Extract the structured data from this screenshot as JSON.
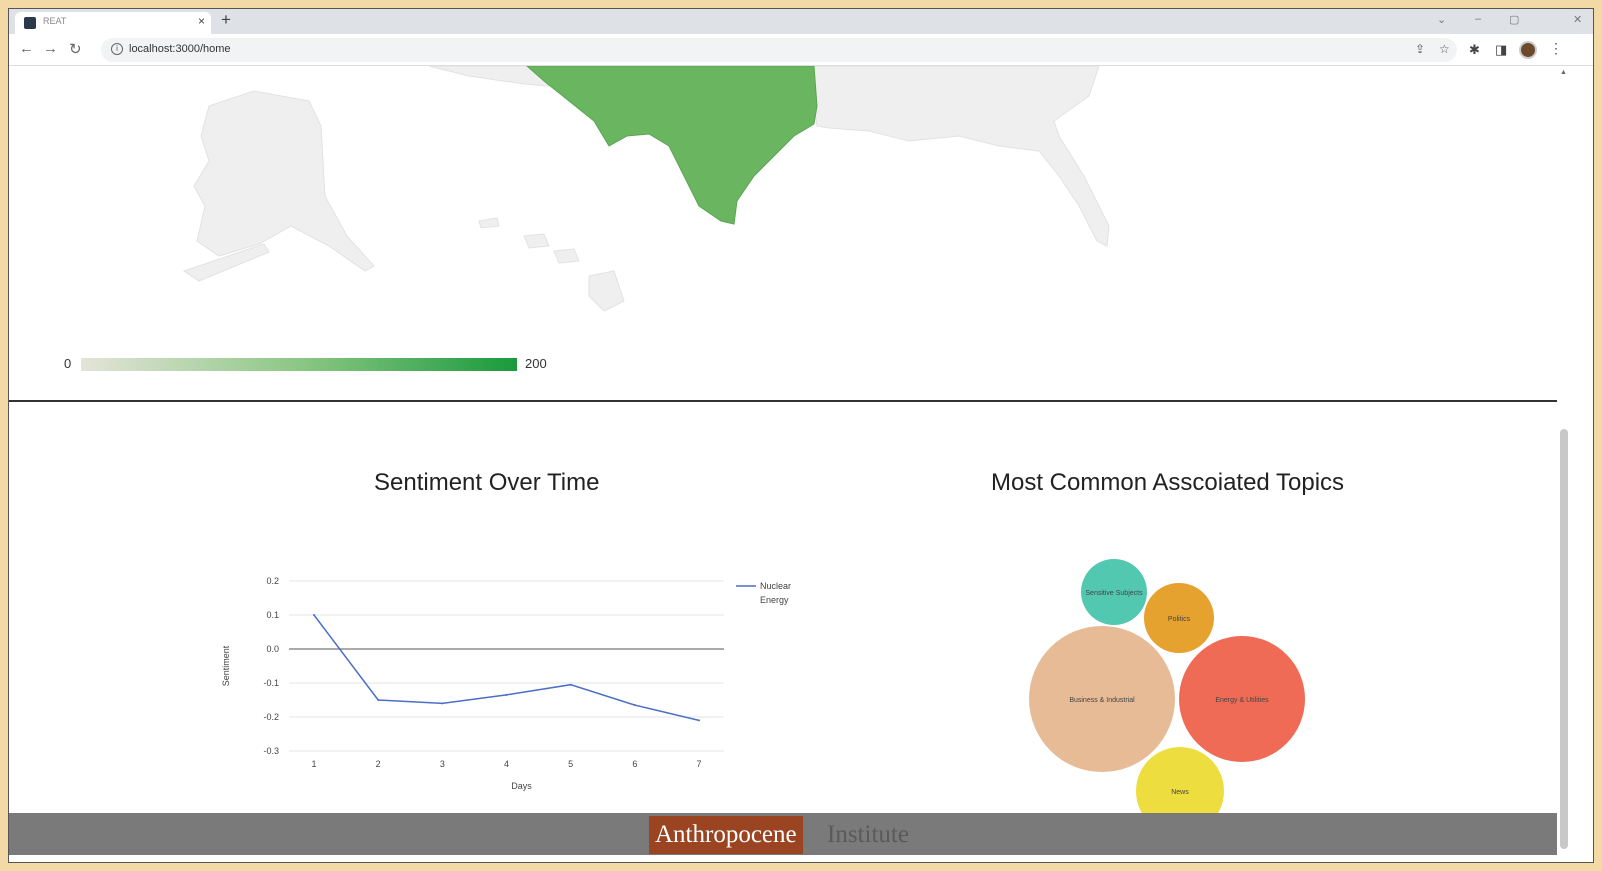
{
  "browser": {
    "tab_title": "REAT",
    "url": "localhost:3000/home"
  },
  "map": {
    "legend_min": "0",
    "legend_max": "200",
    "highlighted_state": "Texas",
    "highlight_color": "#6ab560"
  },
  "charts": {
    "sentiment_title": "Sentiment Over Time",
    "topics_title": "Most Common Asscoiated Topics"
  },
  "chart_data": [
    {
      "type": "line",
      "title": "",
      "xlabel": "Days",
      "ylabel": "Sentiment",
      "x": [
        1,
        2,
        3,
        4,
        5,
        6,
        7
      ],
      "series": [
        {
          "name": "Nuclear Energy",
          "values": [
            0.1,
            -0.15,
            -0.16,
            -0.135,
            -0.105,
            -0.165,
            -0.21
          ]
        }
      ],
      "y_ticks": [
        "0.2",
        "0.1",
        "0.0",
        "-0.1",
        "-0.2",
        "-0.3"
      ],
      "ylim": [
        -0.3,
        0.2
      ],
      "color": "#4a6fc4"
    },
    {
      "type": "bubble",
      "title": "",
      "items": [
        {
          "label": "Sensitive Subjects",
          "color": "#52c8b0"
        },
        {
          "label": "Politics",
          "color": "#e6a22e"
        },
        {
          "label": "Business & Industrial",
          "color": "#e6bb96"
        },
        {
          "label": "Energy & Utilities",
          "color": "#ef6b55"
        },
        {
          "label": "News",
          "color": "#eedd3e"
        }
      ]
    }
  ],
  "footer": {
    "logo_part1": "Anthropocene",
    "logo_part2": "Institute"
  }
}
